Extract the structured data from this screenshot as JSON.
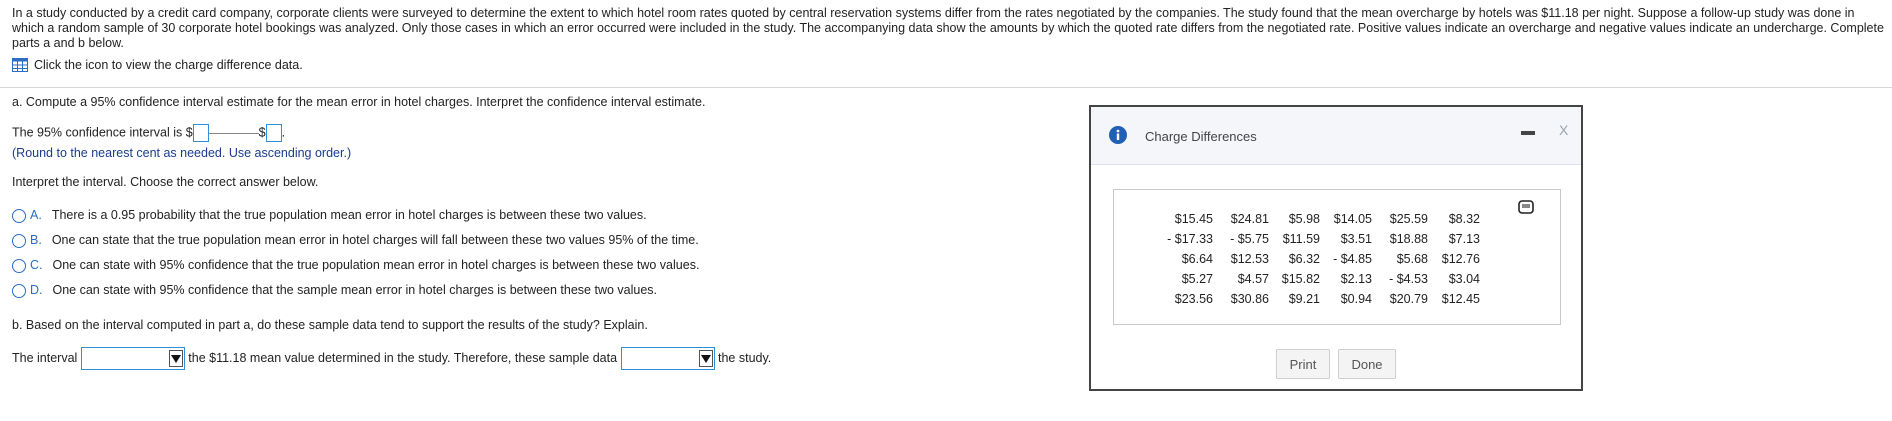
{
  "intro_text": "In a study conducted by a credit card company, corporate clients were surveyed to determine the extent to which hotel room rates quoted by central reservation systems differ from the rates negotiated by the companies. The study found that the mean overcharge by hotels was $11.18 per night. Suppose a follow-up study was done in which a random sample of 30 corporate hotel bookings was analyzed. Only those cases in which an error occurred were included in the study. The accompanying data show the amounts by which the quoted rate differs from the negotiated rate. Positive values indicate an overcharge and negative values indicate an undercharge. Complete parts a and b below.",
  "data_link": "Click the icon to view the charge difference data.",
  "part_a": {
    "question": "a. Compute a 95% confidence interval estimate for the mean error in hotel charges. Interpret the confidence interval estimate.",
    "ci_prefix": "The 95% confidence interval is $",
    "ci_mid": "$",
    "ci_end": ".",
    "round_note": "(Round to the nearest cent as needed. Use ascending order.)",
    "interpret_prompt": "Interpret the interval. Choose the correct answer below.",
    "options": [
      {
        "letter": "A.",
        "text": "There is a 0.95 probability that the true population mean error in hotel charges is between these two values."
      },
      {
        "letter": "B.",
        "text": "One can state that the true population mean error in hotel charges will fall between these two values 95% of the time."
      },
      {
        "letter": "C.",
        "text": "One can state with 95% confidence that the true population mean error in hotel charges is between these two values."
      },
      {
        "letter": "D.",
        "text": "One can state with 95% confidence that the sample mean error in hotel charges is between these two values."
      }
    ]
  },
  "part_b": {
    "question": "b. Based on the interval computed in part a, do these sample data tend to support the results of the study? Explain.",
    "prefix": "The interval",
    "middle": "the $11.18 mean value determined in the study. Therefore, these sample data",
    "suffix": "the study."
  },
  "dialog": {
    "title": "Charge Differences",
    "rows": [
      [
        "$15.45",
        "$24.81",
        "$5.98",
        "$14.05",
        "$25.59",
        "$8.32"
      ],
      [
        "- $17.33",
        "- $5.75",
        "$11.59",
        "$3.51",
        "$18.88",
        "$7.13"
      ],
      [
        "$6.64",
        "$12.53",
        "$6.32",
        "- $4.85",
        "$5.68",
        "$12.76"
      ],
      [
        "$5.27",
        "$4.57",
        "$15.82",
        "$2.13",
        "- $4.53",
        "$3.04"
      ],
      [
        "$23.56",
        "$30.86",
        "$9.21",
        "$0.94",
        "$20.79",
        "$12.45"
      ]
    ],
    "print_label": "Print",
    "done_label": "Done",
    "close_glyph": "X"
  },
  "colors": {
    "accent": "#2f8fd8",
    "option_blue": "#2b6cc4",
    "note_blue": "#1a3c8c"
  },
  "icons": [
    "table-grid-icon",
    "info-icon",
    "minimize-icon",
    "close-icon",
    "copy-data-icon",
    "dropdown-arrow-icon"
  ]
}
